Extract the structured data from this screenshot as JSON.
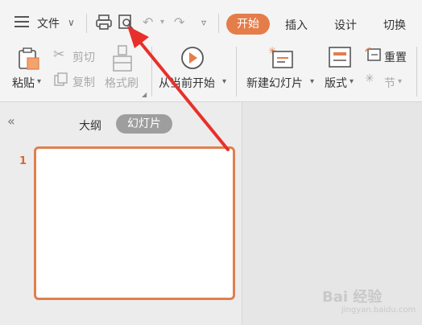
{
  "quick_bar": {
    "file_label": "文件"
  },
  "tabs": [
    {
      "label": "开始"
    },
    {
      "label": "插入"
    },
    {
      "label": "设计"
    },
    {
      "label": "切换"
    }
  ],
  "ribbon": {
    "paste": "粘贴",
    "cut": "剪切",
    "copy": "复制",
    "format_painter": "格式刷",
    "from_current": "从当前开始",
    "new_slide": "新建幻灯片",
    "layout": "版式",
    "reset": "重置",
    "section": "节"
  },
  "panel": {
    "outline_tab": "大纲",
    "slides_tab": "幻灯片",
    "slide_number": "1"
  },
  "watermark": {
    "text": "Bai 经验",
    "sub": "jingyan.baidu.com"
  },
  "colors": {
    "accent": "#e47d4a",
    "arrow": "#e8302a"
  }
}
